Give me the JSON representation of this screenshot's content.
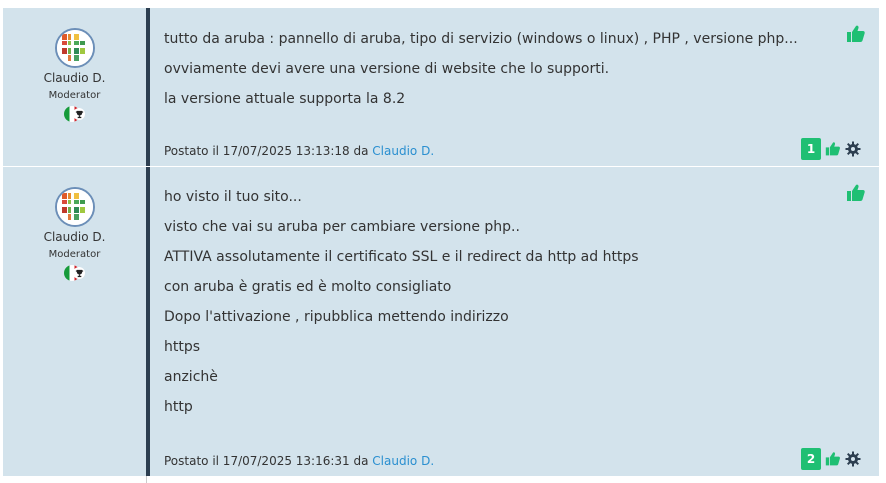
{
  "posts": [
    {
      "author": {
        "name": "Claudio D.",
        "role": "Moderator"
      },
      "lines": [
        "tutto da aruba : pannello di aruba, tipo di servizio (windows o linux) , PHP , versione php...",
        "ovviamente devi avere una versione di website che lo supporti.",
        "la versione attuale supporta la 8.2"
      ],
      "meta": {
        "prefix": "Postato il 17/07/2025 13:13:18 da",
        "author": "Claudio D."
      },
      "likes": "1"
    },
    {
      "author": {
        "name": "Claudio D.",
        "role": "Moderator"
      },
      "lines": [
        "ho visto il tuo sito...",
        "visto che vai su aruba per cambiare versione php..",
        "ATTIVA assolutamente il certificato SSL e il redirect da http ad https",
        "con aruba è gratis ed è molto consigliato",
        "Dopo l'attivazione , ripubblica mettendo indirizzo",
        "https",
        "anzichè",
        "http"
      ],
      "meta": {
        "prefix": "Postato il 17/07/2025 13:16:31 da",
        "author": "Claudio D."
      },
      "likes": "2"
    }
  ],
  "icons": {
    "like": "thumbs-up-icon",
    "settings": "gear-icon",
    "flag": "italy-flag-icon",
    "trophy": "trophy-icon"
  },
  "colors": {
    "post_bg": "#d3e3ec",
    "divider": "#2c3e50",
    "accent_green": "#1fbf73",
    "link": "#2a8fd0"
  }
}
